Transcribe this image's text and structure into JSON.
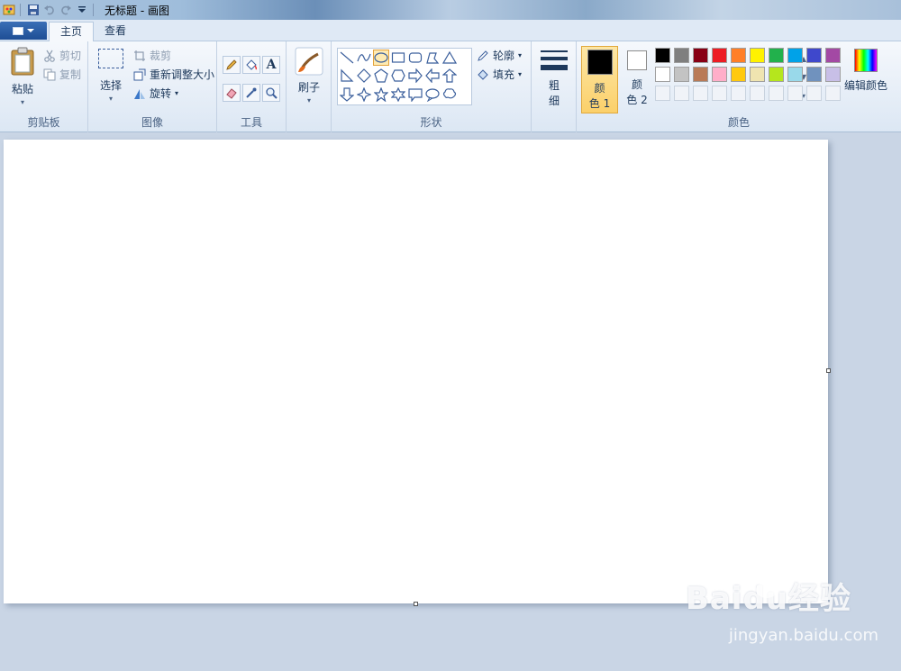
{
  "window": {
    "title": "无标题 - 画图"
  },
  "tabs": [
    {
      "label": "主页"
    },
    {
      "label": "查看"
    }
  ],
  "clipboard": {
    "paste": "粘贴",
    "cut": "剪切",
    "copy": "复制",
    "group": "剪贴板"
  },
  "image": {
    "select": "选择",
    "crop": "裁剪",
    "resize": "重新调整大小",
    "rotate": "旋转",
    "group": "图像"
  },
  "tools": {
    "group": "工具"
  },
  "brushes": {
    "label": "刷子"
  },
  "shapes": {
    "outline": "轮廓",
    "fill": "填充",
    "group": "形状"
  },
  "size": {
    "label1": "粗",
    "label2": "细"
  },
  "colors": {
    "color1_a": "颜",
    "color1_b": "色 1",
    "color2_a": "颜",
    "color2_b": "色 2",
    "edit": "编辑颜色",
    "group": "颜色",
    "color1_value": "#000000",
    "color2_value": "#ffffff",
    "palette_row1": [
      "#000000",
      "#7f7f7f",
      "#880015",
      "#ed1c24",
      "#ff7f27",
      "#fff200",
      "#22b14c",
      "#00a2e8",
      "#3f48cc",
      "#a349a4"
    ],
    "palette_row2": [
      "#ffffff",
      "#c3c3c3",
      "#b97a57",
      "#ffaec9",
      "#ffc90e",
      "#efe4b0",
      "#b5e61d",
      "#99d9ea",
      "#7092be",
      "#c8bfe7"
    ]
  },
  "watermark": {
    "brand": "Baidu经验",
    "url": "jingyan.baidu.com"
  }
}
